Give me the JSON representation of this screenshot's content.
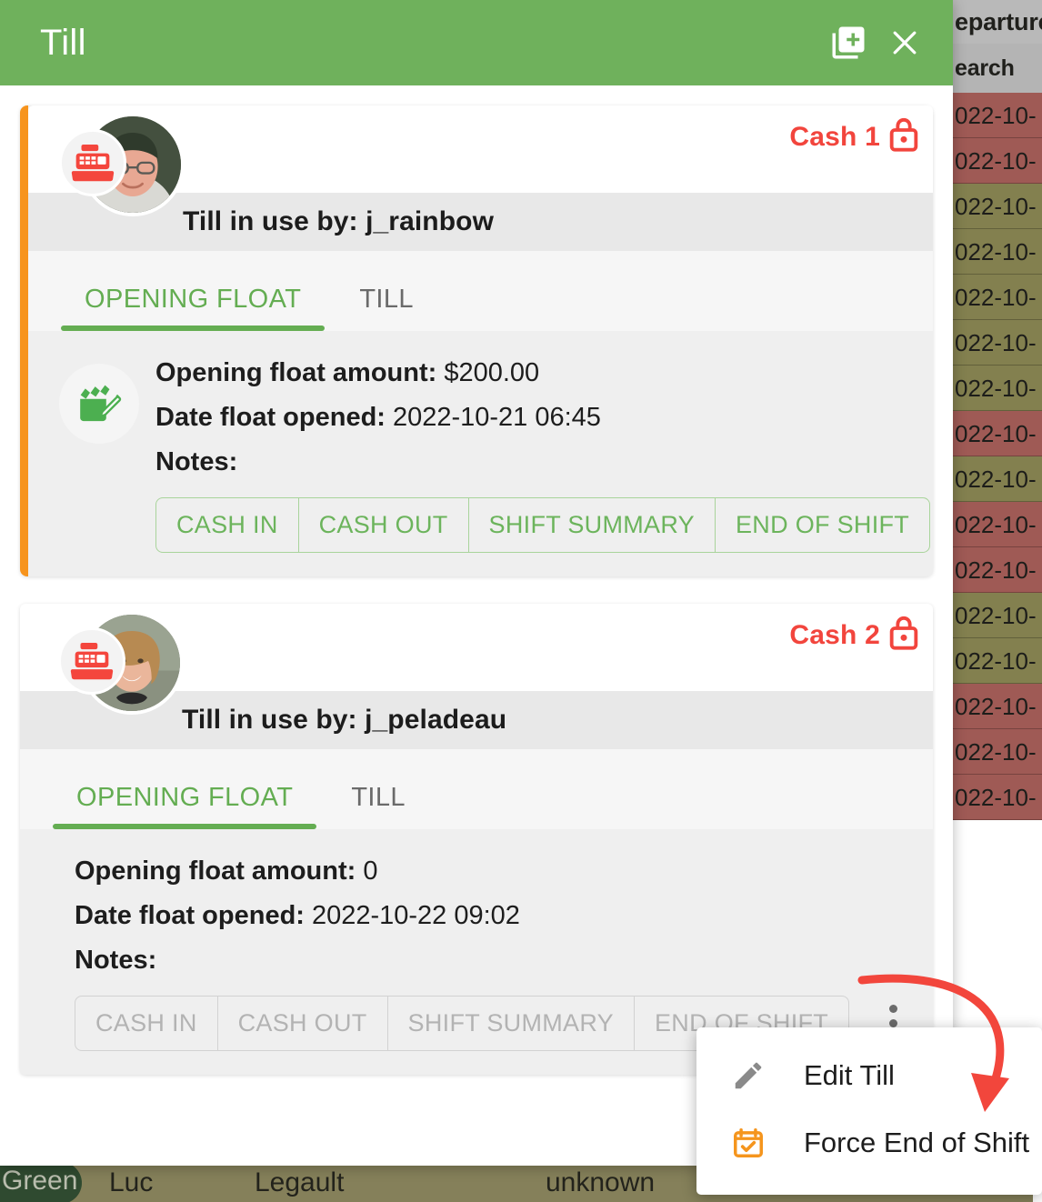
{
  "dialog": {
    "title": "Till",
    "header_actions": [
      {
        "name": "add-till-icon",
        "label": "Add Till"
      },
      {
        "name": "close-icon",
        "label": "Close"
      }
    ]
  },
  "tills": [
    {
      "cash_label": "Cash 1",
      "lock_icon": "lock-icon",
      "locked": true,
      "active": true,
      "register_icon": "cash-register-icon",
      "user_line": "Till in use by: j_rainbow",
      "tabs": [
        {
          "label": "OPENING FLOAT",
          "active": true
        },
        {
          "label": "TILL",
          "active": false
        }
      ],
      "note_icon": "note-edit-icon",
      "fields": [
        {
          "label": "Opening float amount:",
          "value": "$200.00"
        },
        {
          "label": "Date float opened:",
          "value": "2022-10-21 06:45"
        },
        {
          "label": "Notes:",
          "value": ""
        }
      ],
      "buttons": [
        {
          "label": "CASH IN"
        },
        {
          "label": "CASH OUT"
        },
        {
          "label": "SHIFT SUMMARY"
        },
        {
          "label": "END OF SHIFT"
        }
      ],
      "buttons_disabled": false,
      "overflow_icon": "more-vert-icon"
    },
    {
      "cash_label": "Cash 2",
      "lock_icon": "lock-icon",
      "locked": true,
      "active": false,
      "register_icon": "cash-register-icon",
      "user_line": "Till in use by: j_peladeau",
      "tabs": [
        {
          "label": "OPENING FLOAT",
          "active": true
        },
        {
          "label": "TILL",
          "active": false
        }
      ],
      "note_icon": "",
      "fields": [
        {
          "label": "Opening float amount:",
          "value": "0"
        },
        {
          "label": "Date float opened:",
          "value": "2022-10-22 09:02"
        },
        {
          "label": "Notes:",
          "value": ""
        }
      ],
      "buttons": [
        {
          "label": "CASH IN"
        },
        {
          "label": "CASH OUT"
        },
        {
          "label": "SHIFT SUMMARY"
        },
        {
          "label": "END OF SHIFT"
        }
      ],
      "buttons_disabled": true,
      "overflow_icon": "more-vert-icon"
    }
  ],
  "context_menu": {
    "items": [
      {
        "label": "Edit Till",
        "icon": "pencil-icon"
      },
      {
        "label": "Force End of Shift",
        "icon": "calendar-check-icon"
      }
    ]
  },
  "background": {
    "table_headers": [
      "eparture",
      "earch"
    ],
    "rows": [
      {
        "text": "022-10-",
        "tone": "red"
      },
      {
        "text": "022-10-",
        "tone": "red"
      },
      {
        "text": "022-10-",
        "tone": "olive"
      },
      {
        "text": "022-10-",
        "tone": "olive"
      },
      {
        "text": "022-10-",
        "tone": "olive"
      },
      {
        "text": "022-10-",
        "tone": "olive"
      },
      {
        "text": "022-10-",
        "tone": "olive"
      },
      {
        "text": "022-10-",
        "tone": "red"
      },
      {
        "text": "022-10-",
        "tone": "olive"
      },
      {
        "text": "022-10-",
        "tone": "red"
      },
      {
        "text": "022-10-",
        "tone": "red"
      },
      {
        "text": "022-10-",
        "tone": "olive"
      },
      {
        "text": "022-10-",
        "tone": "olive"
      },
      {
        "text": "022-10-",
        "tone": "red"
      },
      {
        "text": "022-10-",
        "tone": "red"
      },
      {
        "text": "022-10-",
        "tone": "red"
      }
    ],
    "bottom_row": {
      "badge": "Green",
      "cells": [
        "Luc",
        "Legault",
        "unknown"
      ]
    }
  },
  "colors": {
    "header_green": "#6fb15c",
    "tab_green": "#64ad52",
    "accent_orange": "#f7941d",
    "danger_red": "#f2453d",
    "annotation_red": "#f2463c",
    "panel_grey": "#efefef"
  }
}
